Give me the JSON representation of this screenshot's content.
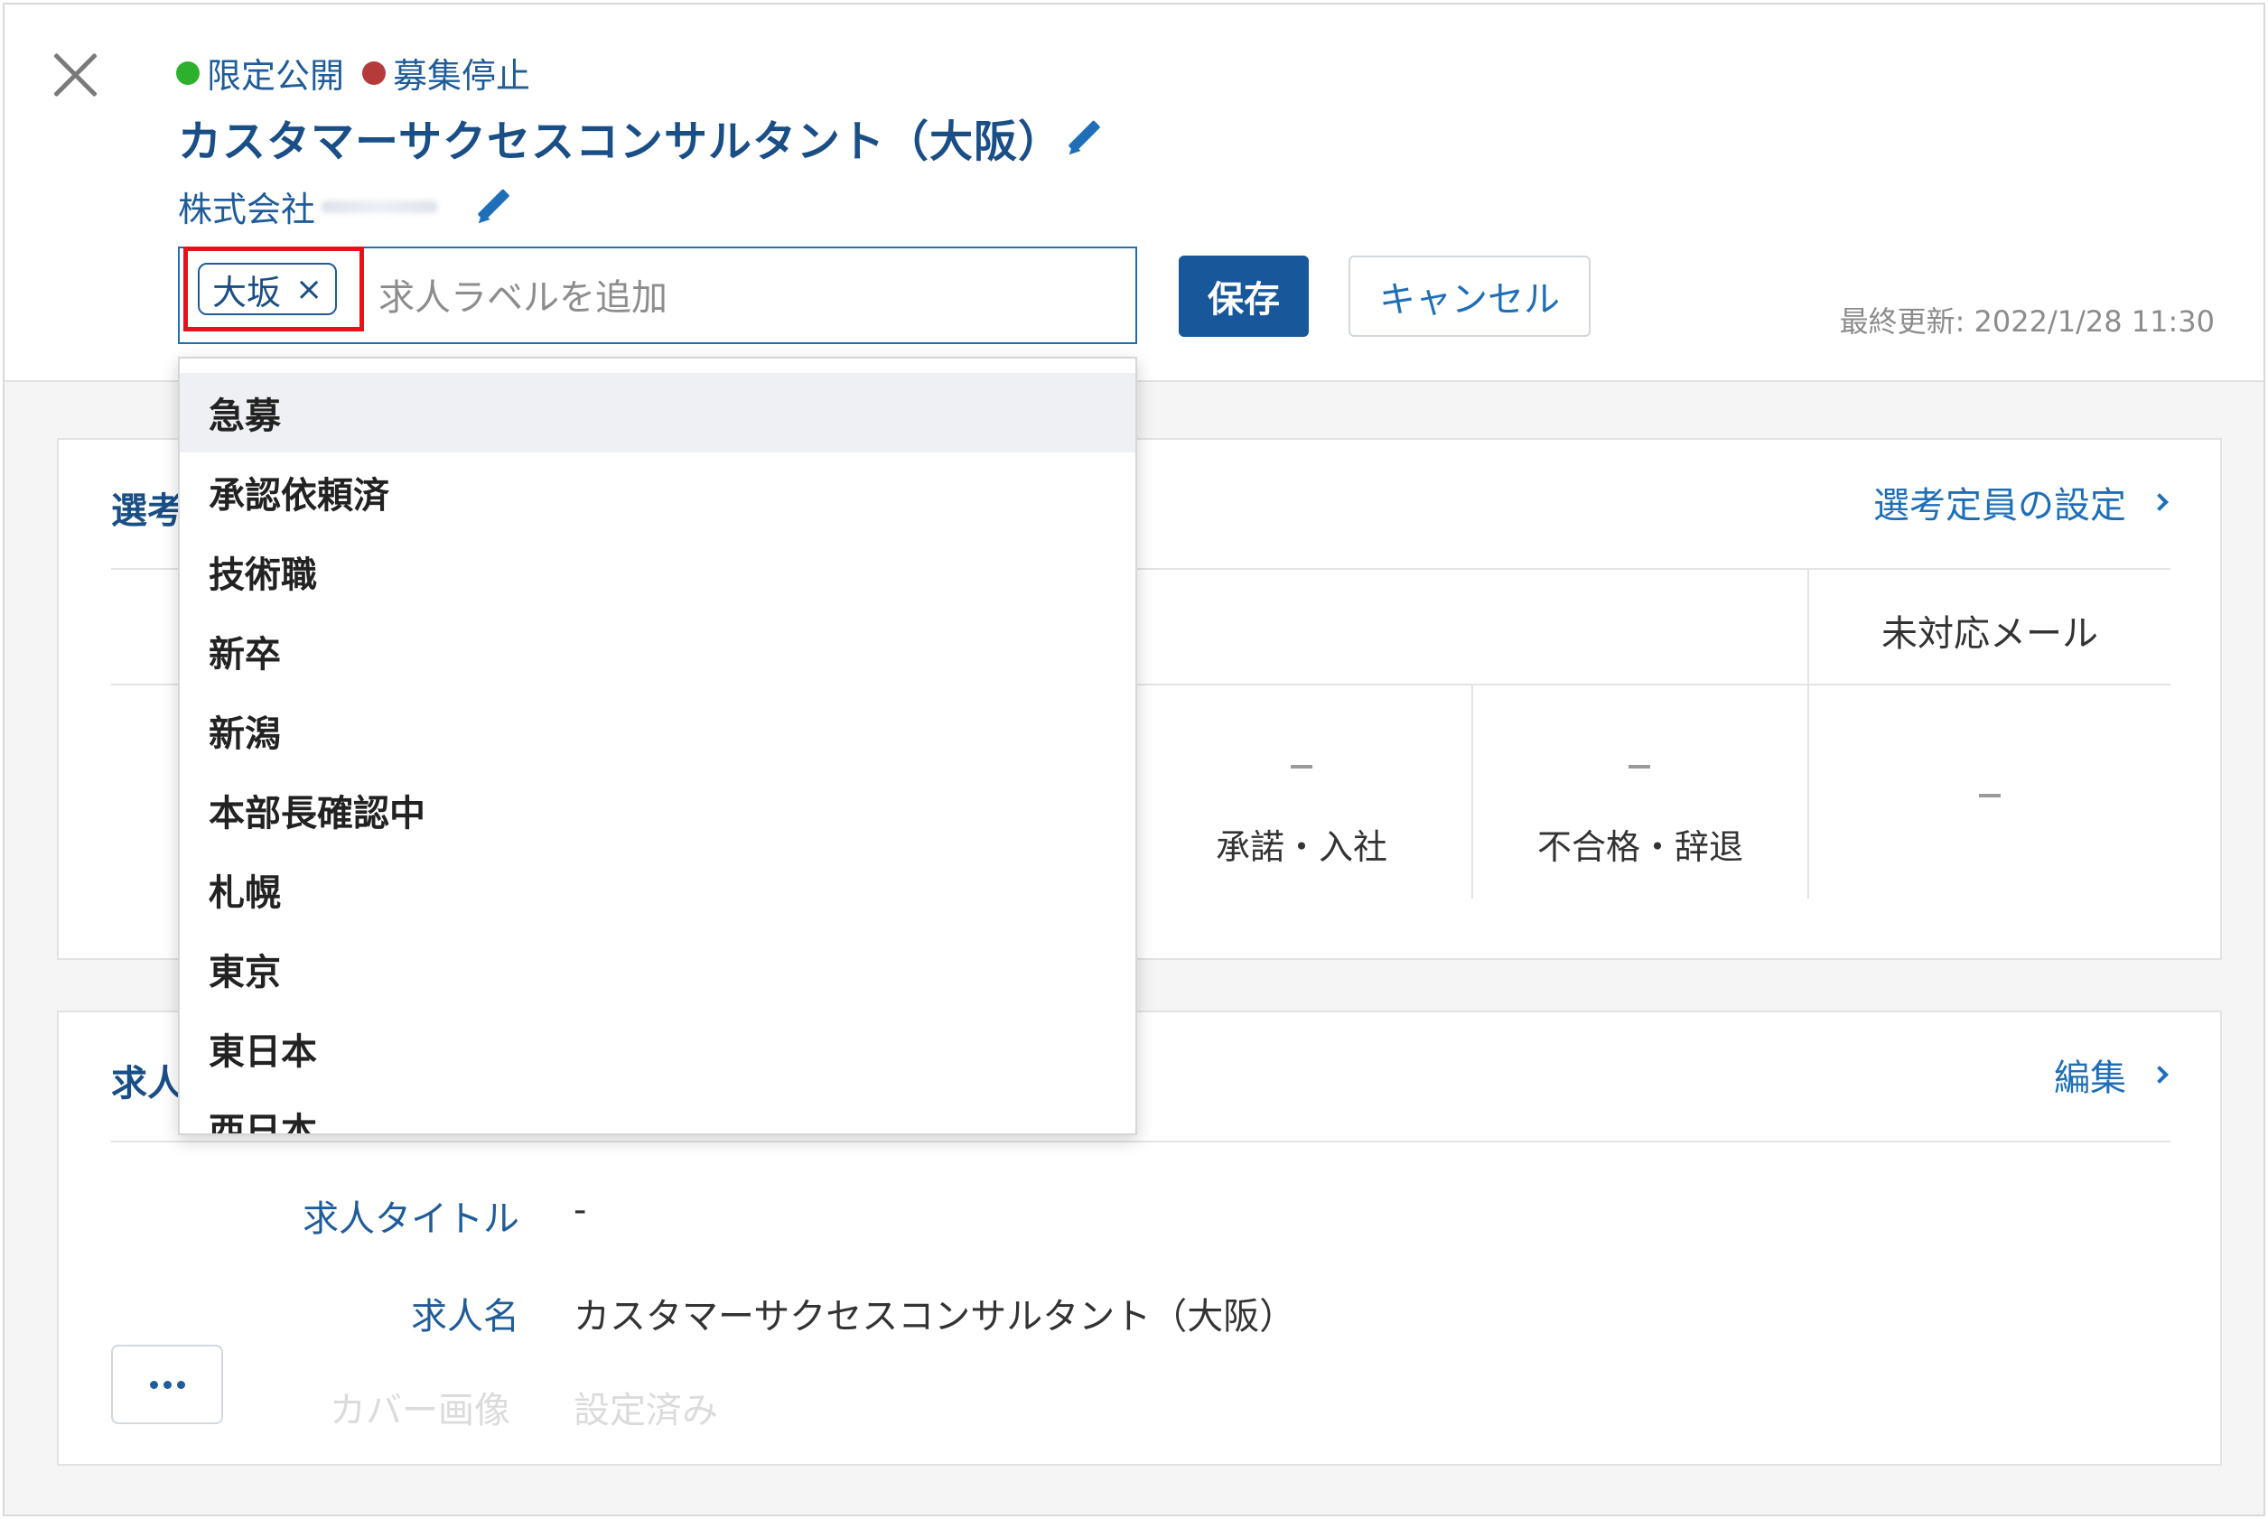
{
  "header": {
    "status_public": "限定公開",
    "status_stopped": "募集停止",
    "job_title": "カスタマーサクセスコンサルタント（大阪）",
    "company_name": "株式会社"
  },
  "label_editor": {
    "chips": [
      {
        "label": "大坂",
        "remove": "×"
      }
    ],
    "placeholder": "求人ラベルを追加",
    "save_label": "保存",
    "cancel_label": "キャンセル",
    "last_updated": "最終更新: 2022/1/28 11:30"
  },
  "dropdown": {
    "items": [
      "急募",
      "承認依頼済",
      "技術職",
      "新卒",
      "新潟",
      "本部長確認中",
      "札幌",
      "東京",
      "東日本",
      "西日本"
    ]
  },
  "selection_card": {
    "title": "選考",
    "link": "選考定員の設定",
    "columns": [
      "未対応メール"
    ],
    "stats": [
      {
        "value": "–",
        "label": "承諾・入社"
      },
      {
        "value": "–",
        "label": "不合格・辞退"
      },
      {
        "value": "–",
        "label": ""
      }
    ]
  },
  "job_card": {
    "title": "求人",
    "link": "編集",
    "fields": [
      {
        "label": "求人タイトル",
        "value": "-"
      },
      {
        "label": "求人名",
        "value": "カスタマーサクセスコンサルタント（大阪）"
      },
      {
        "label": "カバー画像",
        "value": "設定済み"
      }
    ]
  },
  "colors": {
    "primary": "#17579a",
    "link": "#1f6fb8",
    "status_green": "#2db12d",
    "status_red": "#b53a3a",
    "highlight": "#e8101a"
  }
}
